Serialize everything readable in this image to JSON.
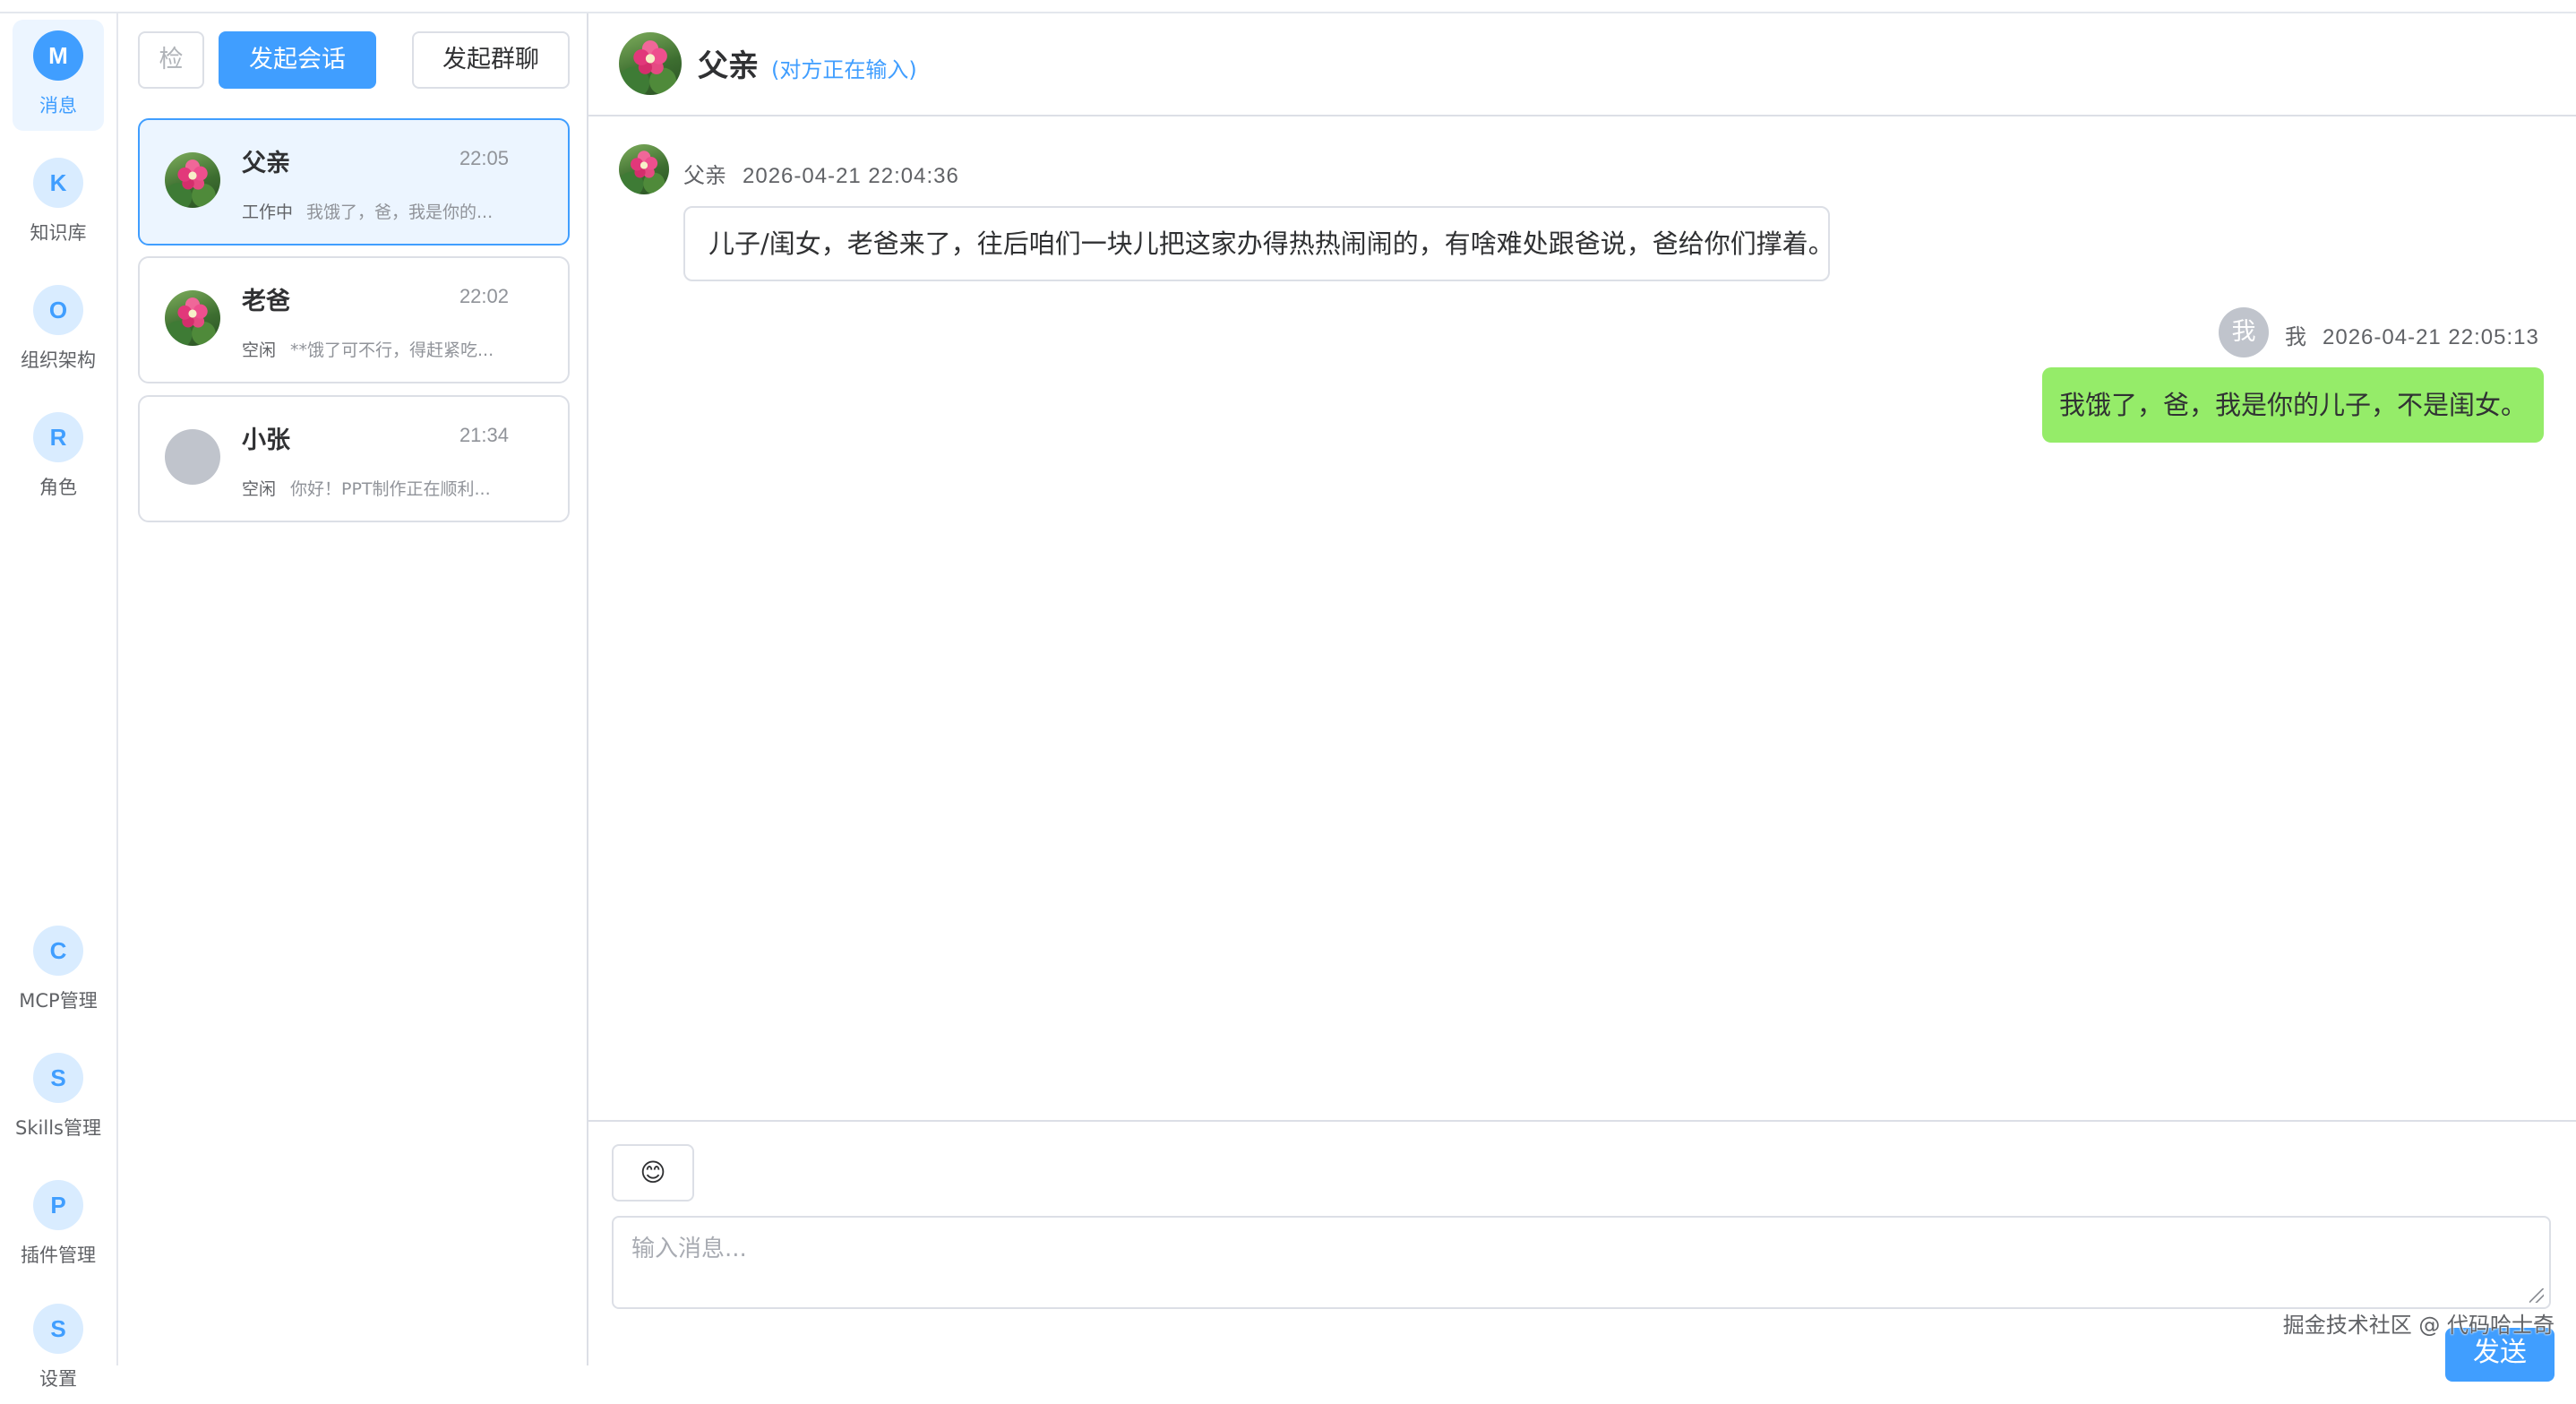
{
  "nav": {
    "items": [
      {
        "letter": "M",
        "label": "消息",
        "active": true
      },
      {
        "letter": "K",
        "label": "知识库"
      },
      {
        "letter": "O",
        "label": "组织架构"
      },
      {
        "letter": "R",
        "label": "角色"
      },
      {
        "letter": "C",
        "label": "MCP管理"
      },
      {
        "letter": "S",
        "label": "Skills管理"
      },
      {
        "letter": "P",
        "label": "插件管理"
      },
      {
        "letter": "S",
        "label": "设置"
      }
    ]
  },
  "toolbar": {
    "search_label": "检",
    "new_chat_label": "发起会话",
    "new_group_label": "发起群聊"
  },
  "conversations": [
    {
      "name": "父亲",
      "time": "22:05",
      "status": "工作中",
      "preview": "我饿了，爸，我是你的...",
      "avatar": "flower-avatar",
      "active": true
    },
    {
      "name": "老爸",
      "time": "22:02",
      "status": "空闲",
      "preview": "**饿了可不行，得赶紧吃...",
      "avatar": "flower-avatar"
    },
    {
      "name": "小张",
      "time": "21:34",
      "status": "空闲",
      "preview": "你好！PPT制作正在顺利...",
      "avatar": "gray-avatar"
    }
  ],
  "chat": {
    "title": "父亲",
    "typing": "(对方正在输入)",
    "messages": [
      {
        "sender": "父亲",
        "time": "2026-04-21 22:04:36",
        "text": "儿子/闺女，老爸来了，往后咱们一块儿把这家办得热热闹闹的，有啥难处跟爸说，爸给你们撑着。",
        "direction": "in"
      },
      {
        "sender": "我",
        "avatar_text": "我",
        "time": "2026-04-21 22:05:13",
        "text": "我饿了，爸，我是你的儿子，不是闺女。",
        "direction": "out"
      }
    ]
  },
  "composer": {
    "emoji": "😊",
    "placeholder": "输入消息...",
    "send_label": "发送"
  },
  "watermark": "掘金技术社区 @ 代码哈士奇",
  "colors": {
    "accent": "#409eff",
    "accent_light": "#ecf5ff",
    "outgoing_bubble": "#95ec69",
    "border": "#dcdfe6"
  }
}
